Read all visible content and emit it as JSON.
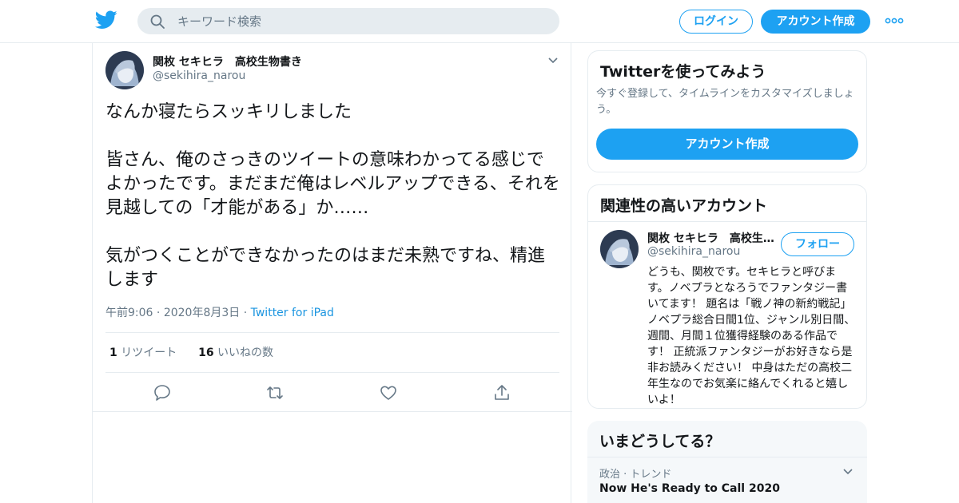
{
  "header": {
    "search_placeholder": "キーワード検索",
    "login_label": "ログイン",
    "signup_label": "アカウント作成"
  },
  "tweet": {
    "author_name": "関枚 セキヒラ　高校生物書き",
    "author_handle": "@sekihira_narou",
    "text": "なんか寝たらスッキリしました\n\n皆さん、俺のさっきのツイートの意味わかってる感じでよかったです。まだまだ俺はレベルアップできる、それを見越しての「才能がある」か……\n\n気がつくことができなかったのはまだ未熟ですね、精進します",
    "time": "午前9:06",
    "date": "2020年8月3日",
    "source": "Twitter for iPad",
    "retweet_count": "1",
    "retweet_label": "リツイート",
    "like_count": "16",
    "like_label": "いいねの数"
  },
  "sidebar": {
    "try_twitter": {
      "title": "Twitterを使ってみよう",
      "description": "今すぐ登録して、タイムラインをカスタマイズしましょう。",
      "button_label": "アカウント作成"
    },
    "related": {
      "title": "関連性の高いアカウント",
      "account_name": "関枚 セキヒラ　高校生物書き",
      "account_handle": "@sekihira_narou",
      "follow_label": "フォロー",
      "bio": "どうも、関枚です。セキヒラと呼びます。ノベプラとなろうでファンタジー書いてます！ 題名は「戦ノ神の新約戦記」ノベプラ総合日間1位、ジャンル別日間、週間、月間１位獲得経験のある作品です！ 正統派ファンタジーがお好きなら是非お読みください！ 中身はただの高校二年生なのでお気楽に絡んでくれると嬉しいよ！"
    },
    "trends": {
      "title": "いまどうしてる？",
      "items": [
        {
          "category": "政治 · トレンド",
          "name": "Now He's Ready to Call 2020"
        }
      ]
    }
  },
  "colors": {
    "accent": "#1da1f2",
    "text": "#14171a",
    "secondary_text": "#657786",
    "border": "#e6ecf0"
  },
  "icons": [
    "twitter-logo-icon",
    "search-icon",
    "more-icon",
    "chevron-down-icon",
    "reply-icon",
    "retweet-icon",
    "like-icon",
    "share-icon"
  ]
}
